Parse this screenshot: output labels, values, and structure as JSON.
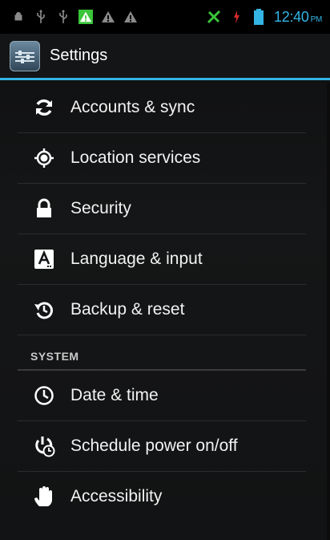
{
  "status_bar": {
    "clock": "12:40",
    "ampm": "PM",
    "icons": [
      "android-debug-icon",
      "usb-icon",
      "usb-icon",
      "warning-green-icon",
      "warning-icon",
      "warning-icon",
      "no-signal-icon",
      "charging-icon",
      "battery-icon"
    ]
  },
  "action_bar": {
    "title": "Settings",
    "icon": "settings-app-icon"
  },
  "items_top": [
    {
      "label": "Accounts & sync",
      "icon": "sync-icon"
    },
    {
      "label": "Location services",
      "icon": "location-icon"
    },
    {
      "label": "Security",
      "icon": "lock-icon"
    },
    {
      "label": "Language & input",
      "icon": "keyboard-icon"
    },
    {
      "label": "Backup & reset",
      "icon": "backup-icon"
    }
  ],
  "section": {
    "label": "SYSTEM"
  },
  "items_system": [
    {
      "label": "Date & time",
      "icon": "clock-icon"
    },
    {
      "label": "Schedule power on/off",
      "icon": "power-schedule-icon"
    },
    {
      "label": "Accessibility",
      "icon": "hand-icon"
    }
  ],
  "colors": {
    "accent": "#33b5e5",
    "background": "#141516",
    "text": "#f2f2f2"
  }
}
